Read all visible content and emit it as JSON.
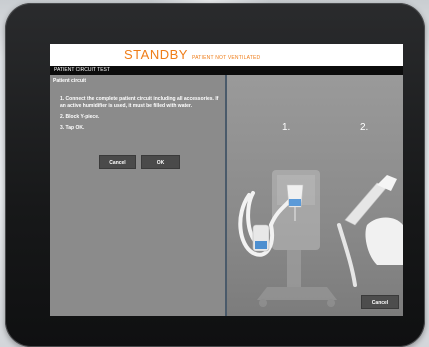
{
  "header": {
    "mode": "STANDBY",
    "status": "PATIENT NOT VENTILATED"
  },
  "titlebar": {
    "title": "PATIENT CIRCUIT TEST"
  },
  "left_panel": {
    "section_label": "Patient circuit",
    "steps": [
      "1. Connect the complete patient circuit including all accessories. If an active humidifier is used, it must be filled with water.",
      "2. Block Y-piece.",
      "3. Tap OK."
    ],
    "cancel_label": "Cancel",
    "ok_label": "OK"
  },
  "right_panel": {
    "step_numbers": [
      "1.",
      "2."
    ],
    "cancel_label": "Cancel"
  },
  "colors": {
    "accent": "#ef7d18",
    "panel": "#8a8a8a",
    "button": "#4a4a4a",
    "divider": "#4a5a6a"
  }
}
